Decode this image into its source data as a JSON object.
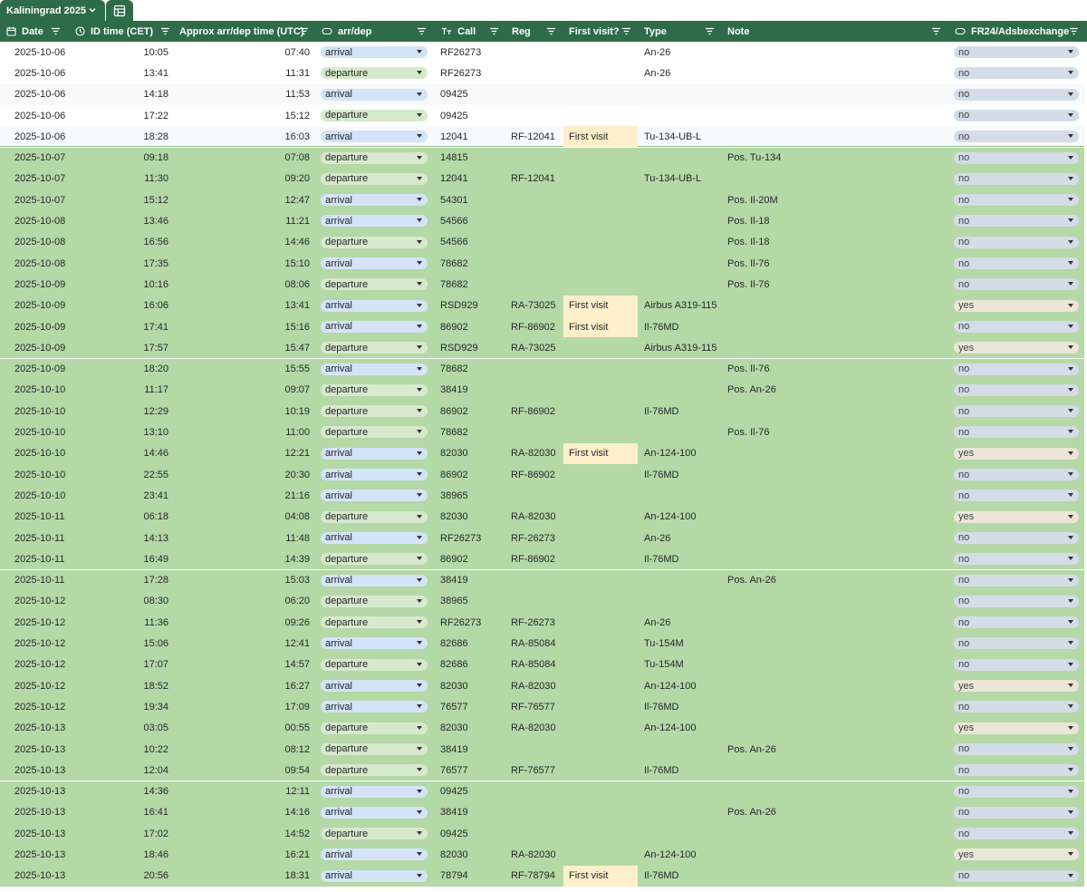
{
  "sheet_tab": {
    "label": "Kaliningrad 2025"
  },
  "headers": {
    "date": "Date",
    "id_time": "ID time (CET)",
    "approx": "Approx arr/dep time (UTC)",
    "arrdep": "arr/dep",
    "call": "Call",
    "reg": "Reg",
    "first_visit": "First visit?",
    "type": "Type",
    "note": "Note",
    "fr24": "FR24/Adsbexchange"
  },
  "colors": {
    "header_bg": "#2e6b48",
    "row_green": "#b4d8a6",
    "first_visit_bg": "#fdefca",
    "chip_arrival": "#d3e4f8",
    "chip_departure": "#d7e9cd",
    "chip_no": "#d4dce8",
    "chip_yes": "#ece6d8"
  },
  "rows": [
    {
      "date": "2025-10-06",
      "id": "10:05",
      "approx": "07:40",
      "dir": "arrival",
      "call": "RF26273",
      "reg": "",
      "first": "",
      "type": "An-26",
      "note": "",
      "fr24": "no",
      "hl": "white"
    },
    {
      "date": "2025-10-06",
      "id": "13:41",
      "approx": "11:31",
      "dir": "departure",
      "call": "RF26273",
      "reg": "",
      "first": "",
      "type": "An-26",
      "note": "",
      "fr24": "no",
      "hl": "white"
    },
    {
      "date": "2025-10-06",
      "id": "14:18",
      "approx": "11:53",
      "dir": "arrival",
      "call": "09425",
      "reg": "",
      "first": "",
      "type": "",
      "note": "",
      "fr24": "no",
      "hl": "alt"
    },
    {
      "date": "2025-10-06",
      "id": "17:22",
      "approx": "15:12",
      "dir": "departure",
      "call": "09425",
      "reg": "",
      "first": "",
      "type": "",
      "note": "",
      "fr24": "no",
      "hl": "white"
    },
    {
      "date": "2025-10-06",
      "id": "18:28",
      "approx": "16:03",
      "dir": "arrival",
      "call": "12041",
      "reg": "RF-12041",
      "first": "First visit",
      "type": "Tu-134-UB-L",
      "note": "",
      "fr24": "no",
      "hl": "alt"
    },
    {
      "date": "2025-10-07",
      "id": "09:18",
      "approx": "07:08",
      "dir": "departure",
      "call": "14815",
      "reg": "",
      "first": "",
      "type": "",
      "note": "Pos. Tu-134",
      "fr24": "no",
      "hl": "green"
    },
    {
      "date": "2025-10-07",
      "id": "11:30",
      "approx": "09:20",
      "dir": "departure",
      "call": "12041",
      "reg": "RF-12041",
      "first": "",
      "type": "Tu-134-UB-L",
      "note": "",
      "fr24": "no",
      "hl": "green"
    },
    {
      "date": "2025-10-07",
      "id": "15:12",
      "approx": "12:47",
      "dir": "arrival",
      "call": "54301",
      "reg": "",
      "first": "",
      "type": "",
      "note": "Pos. Il-20M",
      "fr24": "no",
      "hl": "green"
    },
    {
      "date": "2025-10-08",
      "id": "13:46",
      "approx": "11:21",
      "dir": "arrival",
      "call": "54566",
      "reg": "",
      "first": "",
      "type": "",
      "note": "Pos. Il-18",
      "fr24": "no",
      "hl": "green"
    },
    {
      "date": "2025-10-08",
      "id": "16:56",
      "approx": "14:46",
      "dir": "departure",
      "call": "54566",
      "reg": "",
      "first": "",
      "type": "",
      "note": "Pos. Il-18",
      "fr24": "no",
      "hl": "green"
    },
    {
      "date": "2025-10-08",
      "id": "17:35",
      "approx": "15:10",
      "dir": "arrival",
      "call": "78682",
      "reg": "",
      "first": "",
      "type": "",
      "note": "Pos. Il-76",
      "fr24": "no",
      "hl": "green"
    },
    {
      "date": "2025-10-09",
      "id": "10:16",
      "approx": "08:06",
      "dir": "departure",
      "call": "78682",
      "reg": "",
      "first": "",
      "type": "",
      "note": "Pos. Il-76",
      "fr24": "no",
      "hl": "green"
    },
    {
      "date": "2025-10-09",
      "id": "16:06",
      "approx": "13:41",
      "dir": "arrival",
      "call": "RSD929",
      "reg": "RA-73025",
      "first": "First visit",
      "type": "Airbus A319-115",
      "note": "",
      "fr24": "yes",
      "hl": "green"
    },
    {
      "date": "2025-10-09",
      "id": "17:41",
      "approx": "15:16",
      "dir": "arrival",
      "call": "86902",
      "reg": "RF-86902",
      "first": "First visit",
      "type": "Il-76MD",
      "note": "",
      "fr24": "no",
      "hl": "green"
    },
    {
      "date": "2025-10-09",
      "id": "17:57",
      "approx": "15:47",
      "dir": "departure",
      "call": "RSD929",
      "reg": "RA-73025",
      "first": "",
      "type": "Airbus A319-115",
      "note": "",
      "fr24": "yes",
      "hl": "green"
    },
    {
      "date": "2025-10-09",
      "id": "18:20",
      "approx": "15:55",
      "dir": "arrival",
      "call": "78682",
      "reg": "",
      "first": "",
      "type": "",
      "note": "Pos. Il-76",
      "fr24": "no",
      "hl": "green"
    },
    {
      "date": "2025-10-10",
      "id": "11:17",
      "approx": "09:07",
      "dir": "departure",
      "call": "38419",
      "reg": "",
      "first": "",
      "type": "",
      "note": "Pos. An-26",
      "fr24": "no",
      "hl": "green"
    },
    {
      "date": "2025-10-10",
      "id": "12:29",
      "approx": "10:19",
      "dir": "departure",
      "call": "86902",
      "reg": "RF-86902",
      "first": "",
      "type": "Il-76MD",
      "note": "",
      "fr24": "no",
      "hl": "green"
    },
    {
      "date": "2025-10-10",
      "id": "13:10",
      "approx": "11:00",
      "dir": "departure",
      "call": "78682",
      "reg": "",
      "first": "",
      "type": "",
      "note": "Pos. Il-76",
      "fr24": "no",
      "hl": "green"
    },
    {
      "date": "2025-10-10",
      "id": "14:46",
      "approx": "12:21",
      "dir": "arrival",
      "call": "82030",
      "reg": "RA-82030",
      "first": "First visit",
      "type": "An-124-100",
      "note": "",
      "fr24": "yes",
      "hl": "green"
    },
    {
      "date": "2025-10-10",
      "id": "22:55",
      "approx": "20:30",
      "dir": "arrival",
      "call": "86902",
      "reg": "RF-86902",
      "first": "",
      "type": "Il-76MD",
      "note": "",
      "fr24": "no",
      "hl": "green"
    },
    {
      "date": "2025-10-10",
      "id": "23:41",
      "approx": "21:16",
      "dir": "arrival",
      "call": "38965",
      "reg": "",
      "first": "",
      "type": "",
      "note": "",
      "fr24": "no",
      "hl": "green"
    },
    {
      "date": "2025-10-11",
      "id": "06:18",
      "approx": "04:08",
      "dir": "departure",
      "call": "82030",
      "reg": "RA-82030",
      "first": "",
      "type": "An-124-100",
      "note": "",
      "fr24": "yes",
      "hl": "green"
    },
    {
      "date": "2025-10-11",
      "id": "14:13",
      "approx": "11:48",
      "dir": "arrival",
      "call": "RF26273",
      "reg": "RF-26273",
      "first": "",
      "type": "An-26",
      "note": "",
      "fr24": "no",
      "hl": "green"
    },
    {
      "date": "2025-10-11",
      "id": "16:49",
      "approx": "14:39",
      "dir": "departure",
      "call": "86902",
      "reg": "RF-86902",
      "first": "",
      "type": "Il-76MD",
      "note": "",
      "fr24": "no",
      "hl": "green"
    },
    {
      "date": "2025-10-11",
      "id": "17:28",
      "approx": "15:03",
      "dir": "arrival",
      "call": "38419",
      "reg": "",
      "first": "",
      "type": "",
      "note": "Pos. An-26",
      "fr24": "no",
      "hl": "green"
    },
    {
      "date": "2025-10-12",
      "id": "08:30",
      "approx": "06:20",
      "dir": "departure",
      "call": "38965",
      "reg": "",
      "first": "",
      "type": "",
      "note": "",
      "fr24": "no",
      "hl": "green"
    },
    {
      "date": "2025-10-12",
      "id": "11:36",
      "approx": "09:26",
      "dir": "departure",
      "call": "RF26273",
      "reg": "RF-26273",
      "first": "",
      "type": "An-26",
      "note": "",
      "fr24": "no",
      "hl": "green"
    },
    {
      "date": "2025-10-12",
      "id": "15:06",
      "approx": "12:41",
      "dir": "arrival",
      "call": "82686",
      "reg": "RA-85084",
      "first": "",
      "type": "Tu-154M",
      "note": "",
      "fr24": "no",
      "hl": "green"
    },
    {
      "date": "2025-10-12",
      "id": "17:07",
      "approx": "14:57",
      "dir": "departure",
      "call": "82686",
      "reg": "RA-85084",
      "first": "",
      "type": "Tu-154M",
      "note": "",
      "fr24": "no",
      "hl": "green"
    },
    {
      "date": "2025-10-12",
      "id": "18:52",
      "approx": "16:27",
      "dir": "arrival",
      "call": "82030",
      "reg": "RA-82030",
      "first": "",
      "type": "An-124-100",
      "note": "",
      "fr24": "yes",
      "hl": "green"
    },
    {
      "date": "2025-10-12",
      "id": "19:34",
      "approx": "17:09",
      "dir": "arrival",
      "call": "76577",
      "reg": "RF-76577",
      "first": "",
      "type": "Il-76MD",
      "note": "",
      "fr24": "no",
      "hl": "green"
    },
    {
      "date": "2025-10-13",
      "id": "03:05",
      "approx": "00:55",
      "dir": "departure",
      "call": "82030",
      "reg": "RA-82030",
      "first": "",
      "type": "An-124-100",
      "note": "",
      "fr24": "yes",
      "hl": "green"
    },
    {
      "date": "2025-10-13",
      "id": "10:22",
      "approx": "08:12",
      "dir": "departure",
      "call": "38419",
      "reg": "",
      "first": "",
      "type": "",
      "note": "Pos. An-26",
      "fr24": "no",
      "hl": "green"
    },
    {
      "date": "2025-10-13",
      "id": "12:04",
      "approx": "09:54",
      "dir": "departure",
      "call": "76577",
      "reg": "RF-76577",
      "first": "",
      "type": "Il-76MD",
      "note": "",
      "fr24": "no",
      "hl": "green"
    },
    {
      "date": "2025-10-13",
      "id": "14:36",
      "approx": "12:11",
      "dir": "arrival",
      "call": "09425",
      "reg": "",
      "first": "",
      "type": "",
      "note": "",
      "fr24": "no",
      "hl": "green"
    },
    {
      "date": "2025-10-13",
      "id": "16:41",
      "approx": "14:16",
      "dir": "arrival",
      "call": "38419",
      "reg": "",
      "first": "",
      "type": "",
      "note": "Pos. An-26",
      "fr24": "no",
      "hl": "green"
    },
    {
      "date": "2025-10-13",
      "id": "17:02",
      "approx": "14:52",
      "dir": "departure",
      "call": "09425",
      "reg": "",
      "first": "",
      "type": "",
      "note": "",
      "fr24": "no",
      "hl": "green"
    },
    {
      "date": "2025-10-13",
      "id": "18:46",
      "approx": "16:21",
      "dir": "arrival",
      "call": "82030",
      "reg": "RA-82030",
      "first": "",
      "type": "An-124-100",
      "note": "",
      "fr24": "yes",
      "hl": "green"
    },
    {
      "date": "2025-10-13",
      "id": "20:56",
      "approx": "18:31",
      "dir": "arrival",
      "call": "78794",
      "reg": "RF-78794",
      "first": "First visit",
      "type": "Il-76MD",
      "note": "",
      "fr24": "no",
      "hl": "green"
    }
  ]
}
